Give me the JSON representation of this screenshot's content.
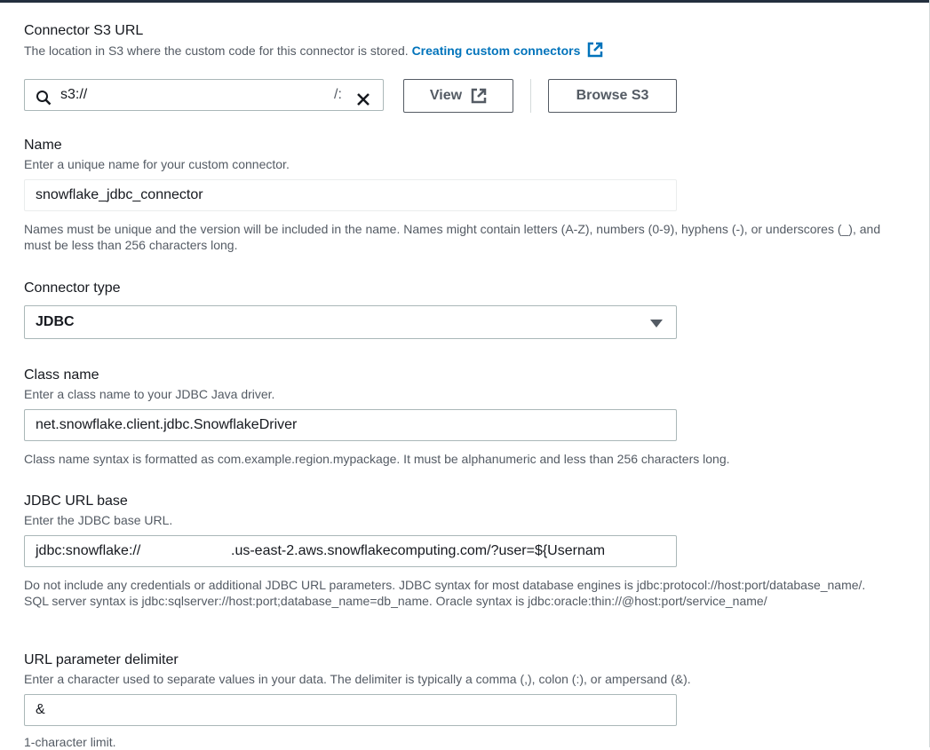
{
  "s3": {
    "label": "Connector S3 URL",
    "description": "The location in S3 where the custom code for this connector is stored.",
    "link_text": "Creating custom connectors",
    "value": "s3://",
    "truncated_suffix": "/:",
    "view_label": "View",
    "browse_label": "Browse S3"
  },
  "name": {
    "label": "Name",
    "description": "Enter a unique name for your custom connector.",
    "value": "snowflake_jdbc_connector",
    "help": "Names must be unique and the version will be included in the name. Names might contain letters (A-Z), numbers (0-9), hyphens (-), or underscores (_), and must be less than 256 characters long."
  },
  "connector_type": {
    "label": "Connector type",
    "selected": "JDBC"
  },
  "class_name": {
    "label": "Class name",
    "description": "Enter a class name to your JDBC Java driver.",
    "value": "net.snowflake.client.jdbc.SnowflakeDriver",
    "help": "Class name syntax is formatted as com.example.region.mypackage. It must be alphanumeric and less than 256 characters long."
  },
  "jdbc_url": {
    "label": "JDBC URL base",
    "description": "Enter the JDBC base URL.",
    "value_prefix": "jdbc:snowflake://",
    "value_suffix": ".us-east-2.aws.snowflakecomputing.com/?user=${Usernam",
    "help": "Do not include any credentials or additional JDBC URL parameters. JDBC syntax for most database engines is jdbc:protocol://host:port/database_name/. SQL server syntax is jdbc:sqlserver://host:port;database_name=db_name. Oracle syntax is jdbc:oracle:thin://@host:port/service_name/"
  },
  "delimiter": {
    "label": "URL parameter delimiter",
    "description": "Enter a character used to separate values in your data. The delimiter is typically a comma (,), colon (:), or ampersand (&).",
    "value": "&",
    "help": "1-character limit."
  },
  "icons": [
    "search-icon",
    "clear-icon",
    "external-link-icon",
    "caret-down-icon"
  ],
  "colors": {
    "link": "#0073bb",
    "text": "#16191f",
    "muted": "#545b64",
    "border": "#aab7b8"
  }
}
